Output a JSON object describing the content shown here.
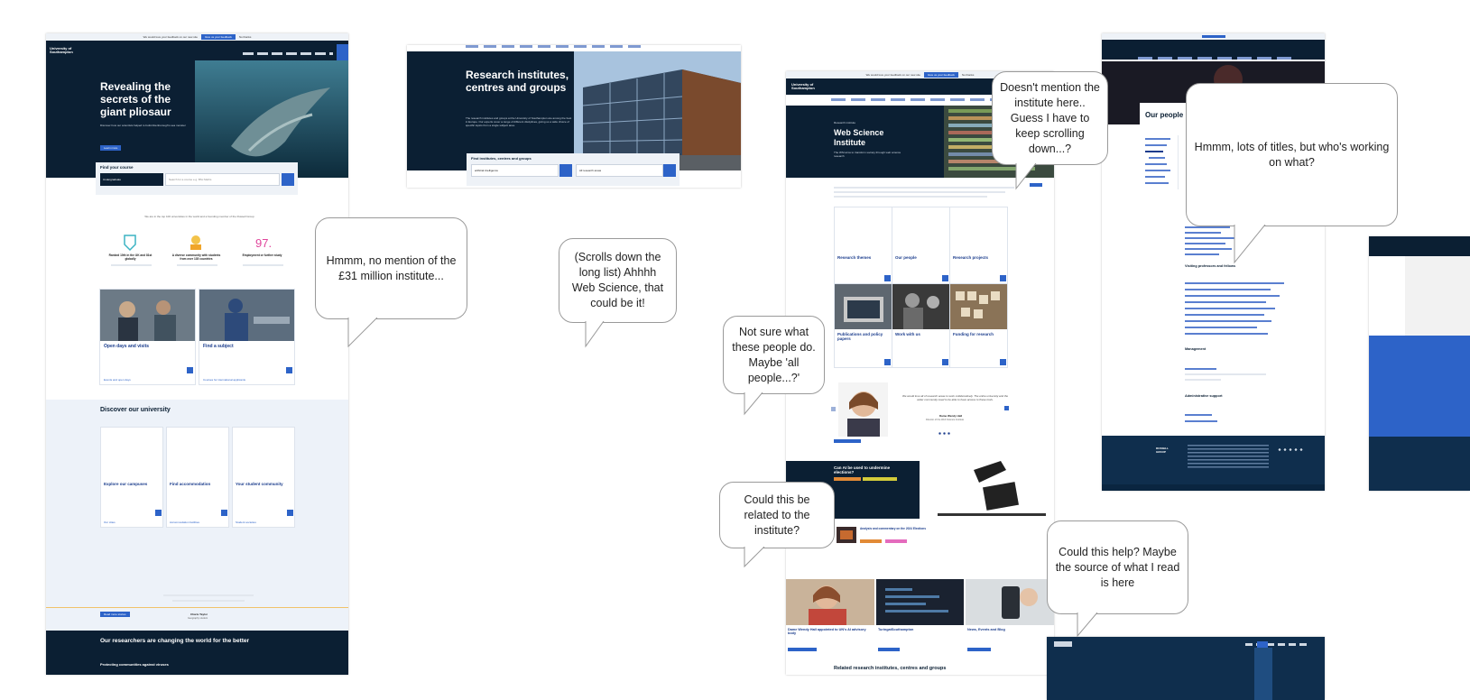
{
  "comments": {
    "c1": "Hmmm, no mention of the £31 million institute...",
    "c2": "(Scrolls down the long list) Ahhhh Web Science, that could be it!",
    "c3": "Doesn't mention the institute here.. Guess I have to keep scrolling down...?",
    "c4": "Hmmm, lots of titles, but who's working on what?",
    "c5": "Not sure what these people do. Maybe 'all people...?'",
    "c6": "Could this be related to the institute?",
    "c7": "Could this help? Maybe the source of what I read is here"
  },
  "shot1": {
    "feedback": "We would love your feedback on our new site",
    "feedback_btn": "Give us your feedback",
    "feedback_link": "No thanks",
    "logo": "University of Southampton",
    "hero_title": "Revealing the secrets of the giant pliosaur",
    "hero_text": "Discover how our scientists helped to build Attenborough's sea monster ",
    "hero_btn": "Learn more",
    "course_title": "Find your course",
    "course_select": "Undergraduate",
    "course_placeholder": "Search for a course e.g. BSc Maths",
    "stats_intro": "We are in the top 100 universities in the world and a founding member of the Russell Group",
    "stat1_title": "Ranked 10th in the UK and 81st globally",
    "stat2_title": "A diverse community with students from over 135 countries",
    "stat3_value": "97.",
    "stat3_title": "Employment or further study",
    "card1_title": "Open days and visits",
    "card2_title": "Find a subject",
    "card1_link": "Events and open days",
    "card2_link": "Courses for international applicants",
    "discover_title": "Discover our university",
    "d1": "Explore our campuses",
    "d2": "Find accommodation",
    "d3": "Your student community",
    "d1_link": "Our cities",
    "d2_link": "Accommodation facilities",
    "d3_link": "Student societies",
    "quote_author": "Charis Taylor",
    "quote_role": "Geography student",
    "more_btn": "Read more stories",
    "research_title": "Our researchers are changing the world for the better",
    "research_item": "Protecting communities against viruses"
  },
  "shot2": {
    "title": "Research institutes, centres and groups",
    "text": "The research institutes and groups at the University of Southampton are among the best in Europe. Our experts cover a range of different disciplines, giving us a wide choice of specific topics from a single subject area.",
    "search_title": "Find institutes, centres and groups",
    "search_value": "artificial intelligence",
    "filter_value": "All research areas"
  },
  "shot3": {
    "feedback": "We would love your feedback on our new site",
    "feedback_btn": "Give us your feedback",
    "feedback_link": "No thanks",
    "logo": "University of Southampton",
    "label": "Research institute",
    "title": "Web Science Institute",
    "intro": "The WSI aims to transform society through web science research",
    "t1": "Research themes",
    "t2": "Our people",
    "t3": "Research projects",
    "t4": "Publications and policy papers",
    "t5": "Work with us",
    "t6": "Funding for research",
    "quote": "We would love all of research areas to work collaboratively. The entire university and the wider community need to be able to have access to these tools.",
    "quote_author": "Dame Wendy Hall",
    "quote_role": "Director of the Web Science Institute",
    "ai_title": "Can AI be used to undermine elections?",
    "news_title": "Analysis and commentary on the 2024 Elections",
    "n1": "Dame Wendy Hall appointed to UN's AI advisory body",
    "n2": "TuringatSouthampton",
    "n3": "News, Events and Blog",
    "related": "Related research institutes, centres and groups"
  },
  "shot4": {
    "people_title": "Our people",
    "visiting_title": "Visiting professors and fellows",
    "management_title": "Management",
    "admin_title": "Administrative support",
    "footer_logo": "RUSSELL GROUP"
  }
}
